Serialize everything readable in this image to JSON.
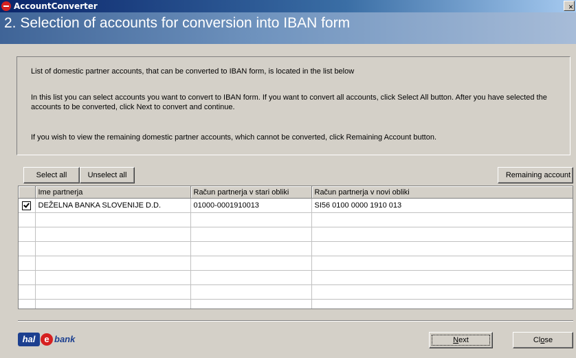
{
  "window": {
    "title": "AccountConverter",
    "close_symbol": "×"
  },
  "header": {
    "title": "2. Selection of accounts for conversion into IBAN form"
  },
  "info": {
    "line1": "List of domestic partner accounts, that can be converted to IBAN form, is located in the list below",
    "line2": "In this list you can select accounts you want to convert to IBAN form. If you want to convert all accounts, click Select All button. After you have selected the accounts to be converted, click Next to convert and continue.",
    "line3": "If you wish to view the remaining domestic partner accounts, which cannot be converted, click Remaining Account button."
  },
  "buttons": {
    "select_all": "Select all",
    "unselect_all": "Unselect all",
    "remaining": "Remaining account",
    "next_pre": "",
    "next_accel": "N",
    "next_post": "ext",
    "close_pre": "Cl",
    "close_accel": "o",
    "close_post": "se"
  },
  "grid": {
    "columns": [
      "Ime partnerja",
      "Račun partnerja v stari obliki",
      "Račun partnerja v novi obliki"
    ],
    "rows": [
      {
        "checked": true,
        "name": "DEŽELNA BANKA SLOVENIJE D.D.",
        "old": "01000-0001910013",
        "new": "SI56 0100 0000 1910 013"
      }
    ]
  },
  "logo": {
    "part1": "hal",
    "part2": "e",
    "part3": "bank"
  },
  "colors": {
    "title_bar": "#0a246a",
    "header": "#3f6497",
    "face": "#d4d0c8",
    "logo_blue": "#1c3f8f",
    "logo_red": "#d62020"
  }
}
